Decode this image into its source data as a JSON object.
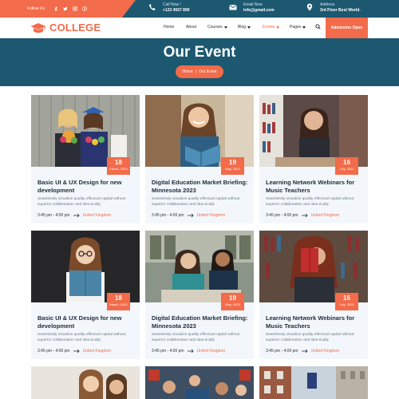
{
  "topbar": {
    "follow_label": "Follow Us",
    "social_icons": [
      "facebook-icon",
      "twitter-icon",
      "instagram-icon",
      "pinterest-icon"
    ],
    "call": {
      "label": "Call Now !",
      "value": "+123 4567 890"
    },
    "email": {
      "label": "Email Now",
      "value": "info@gmail.com"
    },
    "address": {
      "label": "Address",
      "value": "3rd Floor Best World."
    }
  },
  "nav": {
    "logo": "COLLEGE",
    "items": [
      {
        "label": "Home",
        "dropdown": false
      },
      {
        "label": "About",
        "dropdown": false
      },
      {
        "label": "Courses",
        "dropdown": true
      },
      {
        "label": "Blog",
        "dropdown": true
      },
      {
        "label": "Events",
        "dropdown": true
      },
      {
        "label": "Pages",
        "dropdown": true
      }
    ],
    "active_item": "Events",
    "cta": "Admission Open"
  },
  "hero": {
    "title": "Our Event",
    "breadcrumb": [
      "Home",
      "Our Event"
    ]
  },
  "events": [
    {
      "day": "18",
      "month_year": "March, 2023",
      "title": "Basic UI & UX Design for new development",
      "desc": "Seamlessly visualize quality effectual capital without superior collaboration and idea tically",
      "time": "3:45 pm - 4:00 pm",
      "location": "United Kingdom"
    },
    {
      "day": "19",
      "month_year": "May, 2023",
      "title": "Digital Education Market Briefing: Minnesota 2023",
      "desc": "Seamlessly visualize quality effectual capital without superior collaboration and idea tically",
      "time": "3:45 pm - 4:00 pm",
      "location": "United Kingdom"
    },
    {
      "day": "16",
      "month_year": "July, 2023",
      "title": "Learning Network Webinars for Music Teachers",
      "desc": "Seamlessly visualize quality effectual capital without superior collaboration and idea tically",
      "time": "3:45 pm - 4:00 pm",
      "location": "United Kingdom"
    },
    {
      "day": "18",
      "month_year": "March, 2023",
      "title": "Basic UI & UX Design for new development",
      "desc": "Seamlessly visualize quality effectual capital without superior collaboration and idea tically",
      "time": "3:45 pm - 4:00 pm",
      "location": "United Kingdom"
    },
    {
      "day": "19",
      "month_year": "May, 2023",
      "title": "Digital Education Market Briefing: Minnesota 2023",
      "desc": "Seamlessly visualize quality effectual capital without superior collaboration and idea tically",
      "time": "3:45 pm - 4:00 pm",
      "location": "United Kingdom"
    },
    {
      "day": "16",
      "month_year": "July, 2023",
      "title": "Learning Network Webinars for Music Teachers",
      "desc": "Seamlessly visualize quality effectual capital without superior collaboration and idea tically",
      "time": "3:45 pm - 4:00 pm",
      "location": "United Kingdom"
    },
    {
      "day": "",
      "month_year": "",
      "title": "",
      "desc": "",
      "time": "",
      "location": ""
    },
    {
      "day": "",
      "month_year": "",
      "title": "",
      "desc": "",
      "time": "",
      "location": ""
    },
    {
      "day": "",
      "month_year": "",
      "title": "",
      "desc": "",
      "time": "",
      "location": ""
    }
  ],
  "colors": {
    "primary": "#f26b4a",
    "dark": "#1c5870",
    "card_bg": "#f3f7fb",
    "text": "#1c2b3a",
    "muted": "#6b7885"
  }
}
